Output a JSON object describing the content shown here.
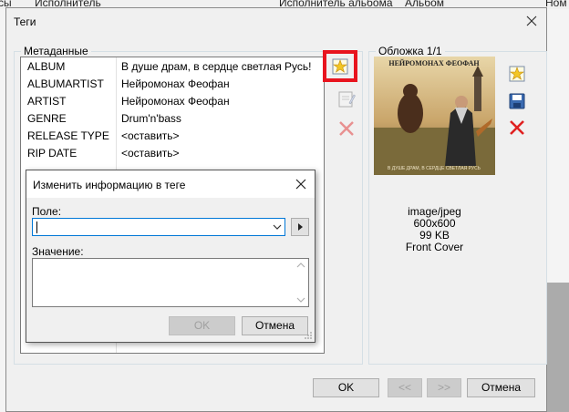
{
  "background": {
    "columns": [
      "Исполнитель",
      "Исполнитель альбома",
      "Альбом",
      "Ном"
    ],
    "left_fragment": "сы"
  },
  "dialog": {
    "title": "Теги",
    "metadata_group": "Метаданные",
    "cover_group": "Обложка 1/1",
    "tags": [
      {
        "key": "ALBUM",
        "value": "В душе драм, в сердце светлая Русь!"
      },
      {
        "key": "ALBUMARTIST",
        "value": "Нейромонах Феофан"
      },
      {
        "key": "ARTIST",
        "value": "Нейромонах Феофан"
      },
      {
        "key": "GENRE",
        "value": "Drum'n'bass"
      },
      {
        "key": "RELEASE TYPE",
        "value": "<оставить>"
      },
      {
        "key": "RIP DATE",
        "value": "<оставить>"
      }
    ],
    "cover": {
      "format": "image/jpeg",
      "dimensions": "600x600",
      "size": "99 KB",
      "type": "Front Cover",
      "band_text": "НЕЙРОМОНАХ ФЕОФАН",
      "bottom_text": "В ДУШЕ ДРАМ, В СЕРДЦЕ СВЕТЛАЯ РУСЬ"
    },
    "buttons": {
      "ok": "OK",
      "prev": "<<",
      "next": ">>",
      "cancel": "Отмена"
    }
  },
  "popup": {
    "title": "Изменить информацию в теге",
    "field_label": "Поле:",
    "field_value": "",
    "value_label": "Значение:",
    "value_text": "",
    "ok": "OK",
    "cancel": "Отмена"
  }
}
